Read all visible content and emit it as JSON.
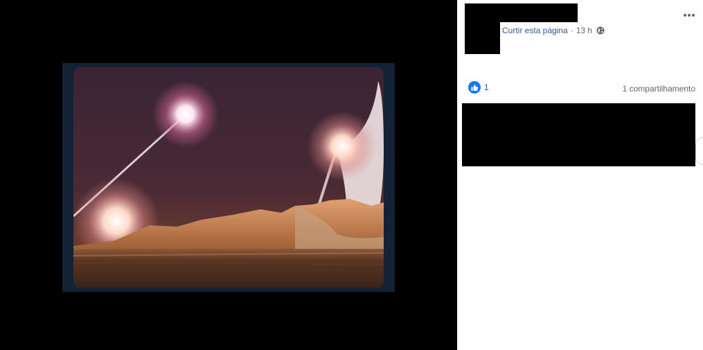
{
  "post": {
    "like_page_link": "Curtir esta página",
    "separator": "·",
    "time": "13 h",
    "audience_icon": "globe-icon",
    "options_icon": "more-options-icon"
  },
  "reactions": {
    "icon": "like-icon",
    "count": "1",
    "shares": "1 compartilhamento"
  },
  "colors": {
    "link": "#385898",
    "like_blue": "#1877f2",
    "meta_text": "#616770",
    "photo_frame": "#142235"
  }
}
